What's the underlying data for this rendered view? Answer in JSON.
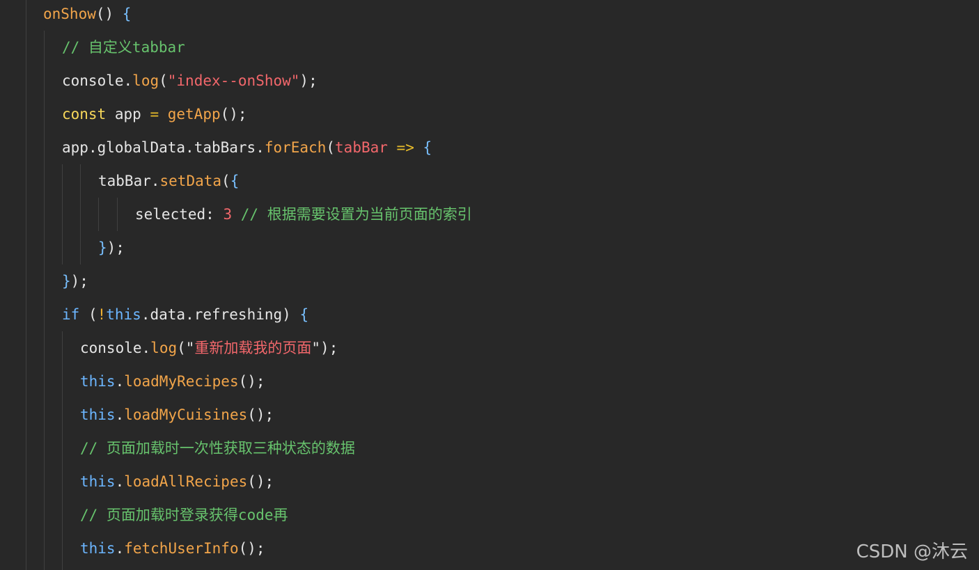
{
  "code": {
    "lines": [
      {
        "indent": 1,
        "tokens": [
          [
            "onShow",
            "func"
          ],
          [
            "() ",
            "punc"
          ],
          [
            "{",
            "brace"
          ]
        ]
      },
      {
        "indent": 2,
        "tokens": [
          [
            "// 自定义tabbar",
            "comment"
          ]
        ]
      },
      {
        "indent": 2,
        "tokens": [
          [
            "console",
            "var"
          ],
          [
            ".",
            "punc"
          ],
          [
            "log",
            "func"
          ],
          [
            "(",
            "punc"
          ],
          [
            "\"index--onShow\"",
            "str"
          ],
          [
            ");",
            "punc"
          ]
        ]
      },
      {
        "indent": 2,
        "tokens": [
          [
            "const",
            "kw"
          ],
          [
            " app ",
            "var"
          ],
          [
            "=",
            "op"
          ],
          [
            " ",
            "text"
          ],
          [
            "getApp",
            "func"
          ],
          [
            "();",
            "punc"
          ]
        ]
      },
      {
        "indent": 2,
        "tokens": [
          [
            "app",
            "var"
          ],
          [
            ".",
            "punc"
          ],
          [
            "globalData",
            "var"
          ],
          [
            ".",
            "punc"
          ],
          [
            "tabBars",
            "var"
          ],
          [
            ".",
            "punc"
          ],
          [
            "forEach",
            "func"
          ],
          [
            "(",
            "punc"
          ],
          [
            "tabBar",
            "param"
          ],
          [
            " ",
            "text"
          ],
          [
            "=>",
            "op"
          ],
          [
            " ",
            "text"
          ],
          [
            "{",
            "brace"
          ]
        ]
      },
      {
        "indent": 4,
        "tokens": [
          [
            "tabBar",
            "var"
          ],
          [
            ".",
            "punc"
          ],
          [
            "setData",
            "func"
          ],
          [
            "(",
            "punc"
          ],
          [
            "{",
            "brace"
          ]
        ]
      },
      {
        "indent": 6,
        "tokens": [
          [
            "selected",
            "var"
          ],
          [
            ": ",
            "punc"
          ],
          [
            "3",
            "num"
          ],
          [
            " ",
            "text"
          ],
          [
            "// 根据需要设置为当前页面的索引",
            "comment"
          ]
        ]
      },
      {
        "indent": 4,
        "tokens": [
          [
            "}",
            "brace"
          ],
          [
            ");",
            "punc"
          ]
        ]
      },
      {
        "indent": 2,
        "tokens": [
          [
            "}",
            "brace"
          ],
          [
            ");",
            "punc"
          ]
        ]
      },
      {
        "indent": 2,
        "tokens": [
          [
            "if",
            "kw2"
          ],
          [
            " (",
            "punc"
          ],
          [
            "!",
            "bang"
          ],
          [
            "this",
            "kw2"
          ],
          [
            ".",
            "punc"
          ],
          [
            "data",
            "var"
          ],
          [
            ".",
            "punc"
          ],
          [
            "refreshing",
            "var"
          ],
          [
            ") ",
            "punc"
          ],
          [
            "{",
            "brace"
          ]
        ]
      },
      {
        "indent": 3,
        "tokens": [
          [
            "console",
            "var"
          ],
          [
            ".",
            "punc"
          ],
          [
            "log",
            "func"
          ],
          [
            "(\"",
            "punc"
          ],
          [
            "重新加载我的页面",
            "str"
          ],
          [
            "\");",
            "punc"
          ]
        ]
      },
      {
        "indent": 3,
        "tokens": [
          [
            "this",
            "kw2"
          ],
          [
            ".",
            "punc"
          ],
          [
            "loadMyRecipes",
            "func"
          ],
          [
            "();",
            "punc"
          ]
        ]
      },
      {
        "indent": 3,
        "tokens": [
          [
            "this",
            "kw2"
          ],
          [
            ".",
            "punc"
          ],
          [
            "loadMyCuisines",
            "func"
          ],
          [
            "();",
            "punc"
          ]
        ]
      },
      {
        "indent": 3,
        "tokens": [
          [
            "// 页面加载时一次性获取三种状态的数据",
            "comment"
          ]
        ]
      },
      {
        "indent": 3,
        "tokens": [
          [
            "this",
            "kw2"
          ],
          [
            ".",
            "punc"
          ],
          [
            "loadAllRecipes",
            "func"
          ],
          [
            "();",
            "punc"
          ]
        ]
      },
      {
        "indent": 3,
        "tokens": [
          [
            "// 页面加载时登录获得code再",
            "comment"
          ]
        ]
      },
      {
        "indent": 3,
        "tokens": [
          [
            "this",
            "kw2"
          ],
          [
            ".",
            "punc"
          ],
          [
            "fetchUserInfo",
            "func"
          ],
          [
            "();",
            "punc"
          ]
        ]
      }
    ]
  },
  "watermark": "CSDN @沐云",
  "colors": {
    "background": "#282828",
    "function": "#f2a54a",
    "keyword": "#f8d85a",
    "keyword_this": "#6cb6ff",
    "string": "#f2676b",
    "comment": "#67c36d",
    "brace": "#79c0ff",
    "indent_guide": "#404040"
  }
}
